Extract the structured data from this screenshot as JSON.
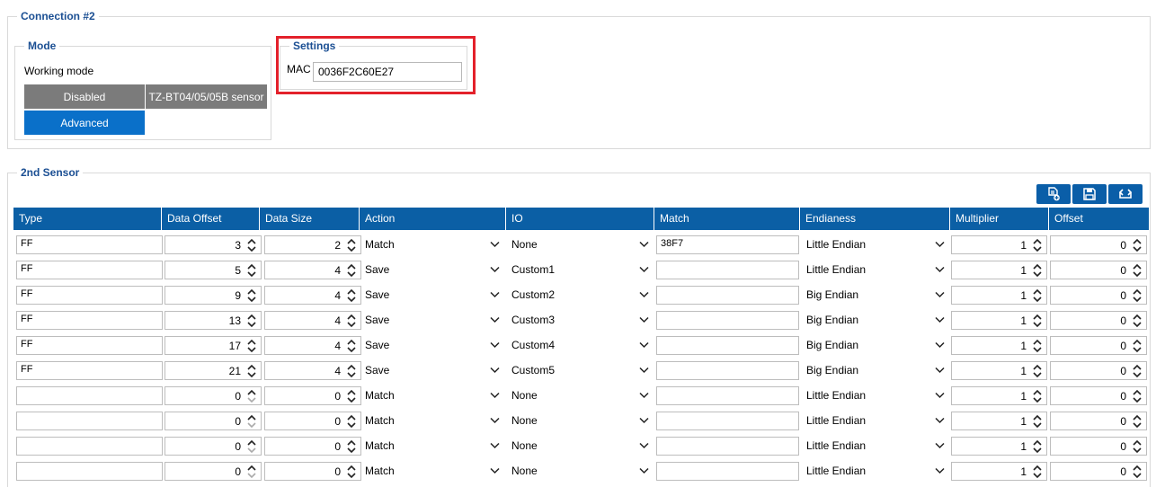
{
  "connection": {
    "title": "Connection #2"
  },
  "mode": {
    "title": "Mode",
    "working_mode_label": "Working mode",
    "buttons": {
      "disabled": "Disabled",
      "sensor": "TZ-BT04/05/05B sensor",
      "advanced": "Advanced"
    },
    "selected": "Advanced"
  },
  "settings": {
    "title": "Settings",
    "mac_label": "MAC",
    "mac_value": "0036F2C60E27"
  },
  "sensor": {
    "title": "2nd Sensor"
  },
  "toolbar": {
    "icons": [
      "add-row-icon",
      "save-icon",
      "refresh-icon"
    ]
  },
  "table": {
    "headers": [
      "Type",
      "Data Offset",
      "Data Size",
      "Action",
      "IO",
      "Match",
      "Endianess",
      "Multiplier",
      "Offset"
    ],
    "rows": [
      {
        "type": "FF",
        "data_offset": "3",
        "data_size": "2",
        "action": "Match",
        "io": "None",
        "match": "38F7",
        "endianess": "Little Endian",
        "multiplier": "1",
        "offset": "0"
      },
      {
        "type": "FF",
        "data_offset": "5",
        "data_size": "4",
        "action": "Save",
        "io": "Custom1",
        "match": "",
        "endianess": "Little Endian",
        "multiplier": "1",
        "offset": "0"
      },
      {
        "type": "FF",
        "data_offset": "9",
        "data_size": "4",
        "action": "Save",
        "io": "Custom2",
        "match": "",
        "endianess": "Big Endian",
        "multiplier": "1",
        "offset": "0"
      },
      {
        "type": "FF",
        "data_offset": "13",
        "data_size": "4",
        "action": "Save",
        "io": "Custom3",
        "match": "",
        "endianess": "Big Endian",
        "multiplier": "1",
        "offset": "0"
      },
      {
        "type": "FF",
        "data_offset": "17",
        "data_size": "4",
        "action": "Save",
        "io": "Custom4",
        "match": "",
        "endianess": "Big Endian",
        "multiplier": "1",
        "offset": "0"
      },
      {
        "type": "FF",
        "data_offset": "21",
        "data_size": "4",
        "action": "Save",
        "io": "Custom5",
        "match": "",
        "endianess": "Big Endian",
        "multiplier": "1",
        "offset": "0"
      },
      {
        "type": "",
        "data_offset": "0",
        "data_size": "0",
        "action": "Match",
        "io": "None",
        "match": "",
        "endianess": "Little Endian",
        "multiplier": "1",
        "offset": "0"
      },
      {
        "type": "",
        "data_offset": "0",
        "data_size": "0",
        "action": "Match",
        "io": "None",
        "match": "",
        "endianess": "Little Endian",
        "multiplier": "1",
        "offset": "0"
      },
      {
        "type": "",
        "data_offset": "0",
        "data_size": "0",
        "action": "Match",
        "io": "None",
        "match": "",
        "endianess": "Little Endian",
        "multiplier": "1",
        "offset": "0"
      },
      {
        "type": "",
        "data_offset": "0",
        "data_size": "0",
        "action": "Match",
        "io": "None",
        "match": "",
        "endianess": "Little Endian",
        "multiplier": "1",
        "offset": "0"
      }
    ]
  },
  "colors": {
    "accent": "#0b5fa5",
    "highlight": "#e3212b",
    "disabled_gray": "#7b7b7b",
    "selected_blue": "#0a70c9"
  }
}
